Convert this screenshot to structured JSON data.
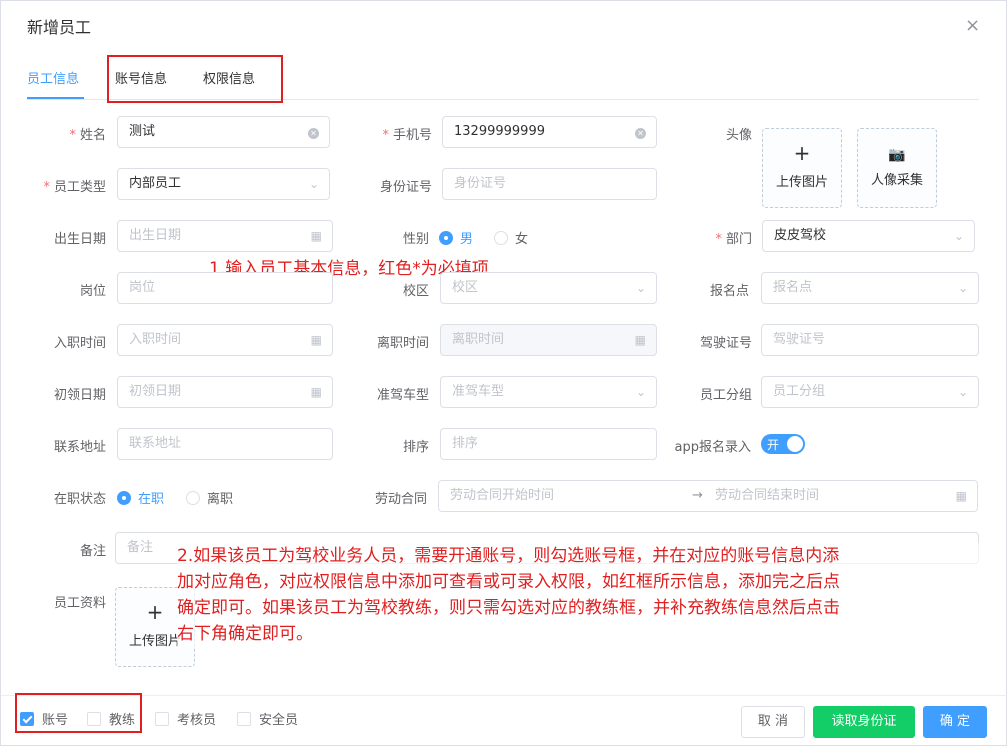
{
  "dialog": {
    "title": "新增员工",
    "close_icon": "×"
  },
  "tabs": [
    {
      "label": "员工信息",
      "active": true
    },
    {
      "label": "账号信息",
      "active": false
    },
    {
      "label": "权限信息",
      "active": false
    }
  ],
  "form": {
    "name": {
      "label": "姓名",
      "value": "测试",
      "required": true
    },
    "phone": {
      "label": "手机号",
      "value": "13299999999",
      "required": true
    },
    "avatar": {
      "label": "头像",
      "upload_label": "上传图片",
      "capture_label": "人像采集"
    },
    "employee_type": {
      "label": "员工类型",
      "value": "内部员工",
      "required": true
    },
    "id_card": {
      "label": "身份证号",
      "placeholder": "身份证号"
    },
    "birth_date": {
      "label": "出生日期",
      "placeholder": "出生日期"
    },
    "gender": {
      "label": "性别",
      "options": [
        "男",
        "女"
      ],
      "selected": "男"
    },
    "department": {
      "label": "部门",
      "value": "皮皮驾校",
      "required": true
    },
    "position": {
      "label": "岗位",
      "placeholder": "岗位"
    },
    "campus": {
      "label": "校区",
      "placeholder": "校区"
    },
    "registration_point": {
      "label": "报名点",
      "placeholder": "报名点"
    },
    "hire_date": {
      "label": "入职时间",
      "placeholder": "入职时间"
    },
    "leave_date": {
      "label": "离职时间",
      "placeholder": "离职时间"
    },
    "license_no": {
      "label": "驾驶证号",
      "placeholder": "驾驶证号"
    },
    "first_license_date": {
      "label": "初领日期",
      "placeholder": "初领日期"
    },
    "vehicle_type": {
      "label": "准驾车型",
      "placeholder": "准驾车型"
    },
    "employee_group": {
      "label": "员工分组",
      "placeholder": "员工分组"
    },
    "address": {
      "label": "联系地址",
      "placeholder": "联系地址"
    },
    "sort": {
      "label": "排序",
      "placeholder": "排序"
    },
    "app_entry": {
      "label": "app报名录入",
      "switch_text": "开",
      "on": true
    },
    "status": {
      "label": "在职状态",
      "options": [
        "在职",
        "离职"
      ],
      "selected": "在职"
    },
    "contract": {
      "label": "劳动合同",
      "start_placeholder": "劳动合同开始时间",
      "separator": "→",
      "end_placeholder": "劳动合同结束时间"
    },
    "remark": {
      "label": "备注",
      "placeholder": "备注"
    },
    "documents": {
      "label": "员工资料",
      "upload_label": "上传图片"
    }
  },
  "annotations": {
    "note1": "1.输入员工基本信息，红色*为必填项",
    "note2_line1": "2.如果该员工为驾校业务人员，需要开通账号，则勾选账号框，并在对应的账号信息内添",
    "note2_line2": "加对应角色，对应权限信息中添加可查看或可录入权限，如红框所示信息，添加完之后点",
    "note2_line3": "确定即可。如果该员工为驾校教练，则只需勾选对应的教练框，并补充教练信息然后点击",
    "note2_line4": "右下角确定即可。"
  },
  "footer": {
    "checkboxes": [
      {
        "label": "账号",
        "checked": true
      },
      {
        "label": "教练",
        "checked": false
      },
      {
        "label": "考核员",
        "checked": false
      },
      {
        "label": "安全员",
        "checked": false
      }
    ],
    "cancel_label": "取 消",
    "read_id_label": "读取身份证",
    "confirm_label": "确 定"
  },
  "colors": {
    "primary": "#409eff",
    "success": "#13ce66",
    "annotation": "#e02020",
    "required": "#f56c6c"
  },
  "icons": {
    "clear": "circle-close-icon",
    "calendar": "calendar-icon",
    "select": "chevron-down-icon",
    "plus": "plus-icon",
    "camera": "camera-icon"
  }
}
